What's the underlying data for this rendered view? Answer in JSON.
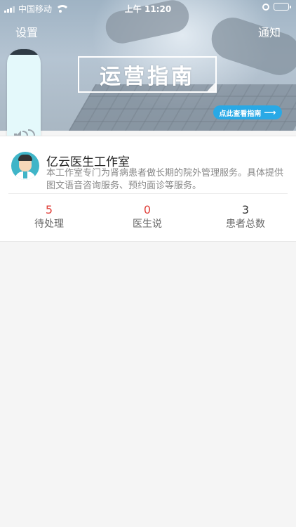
{
  "status_bar": {
    "carrier": "中国移动",
    "time": "上午 11:20"
  },
  "nav": {
    "left_label": "设置",
    "right_label": "通知"
  },
  "banner": {
    "title": "运营指南",
    "cta_label": "点此查看指南",
    "cta_arrow": "⟶"
  },
  "studio": {
    "name": "亿云医生工作室",
    "description": "本工作室专门为肾病患者做长期的院外管理服务。具体提供图文语音咨询服务、预约面诊等服务。"
  },
  "stats": [
    {
      "value": "5",
      "label": "待处理",
      "color": "#e0413b"
    },
    {
      "value": "0",
      "label": "医生说",
      "color": "#e0413b"
    },
    {
      "value": "3",
      "label": "患者总数",
      "color": "#333333"
    }
  ],
  "icons": {
    "voice_panel": "speaker-icon",
    "avatar": "doctor-avatar-icon"
  }
}
